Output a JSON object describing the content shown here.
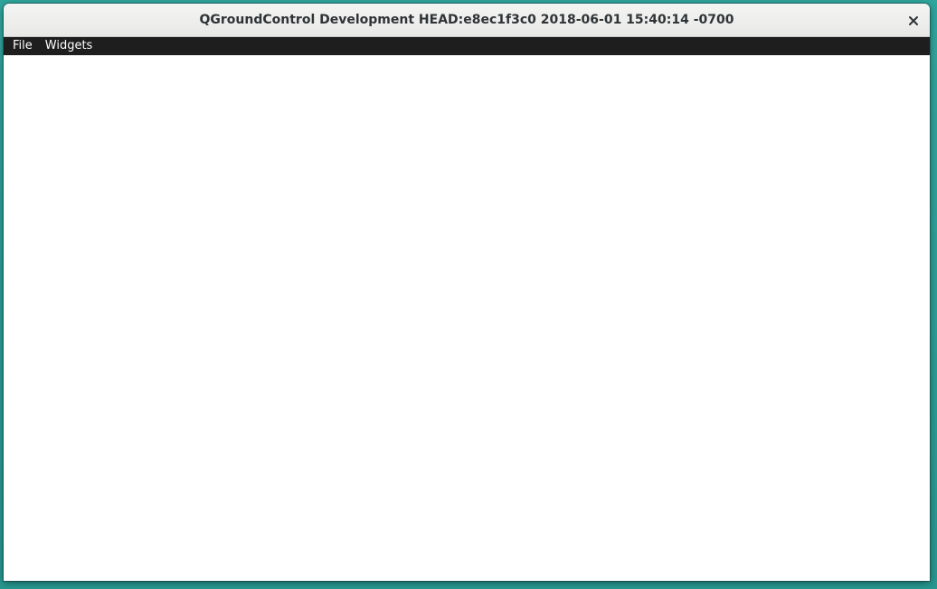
{
  "window": {
    "title": "QGroundControl Development HEAD:e8ec1f3c0 2018-06-01 15:40:14 -0700",
    "close_icon": "close-icon"
  },
  "menubar": {
    "items": [
      {
        "label": "File"
      },
      {
        "label": "Widgets"
      }
    ]
  },
  "colors": {
    "desktop": "#2a9d94",
    "menubar": "#1e1e1e",
    "titlebar": "#ededec",
    "content": "#ffffff"
  }
}
